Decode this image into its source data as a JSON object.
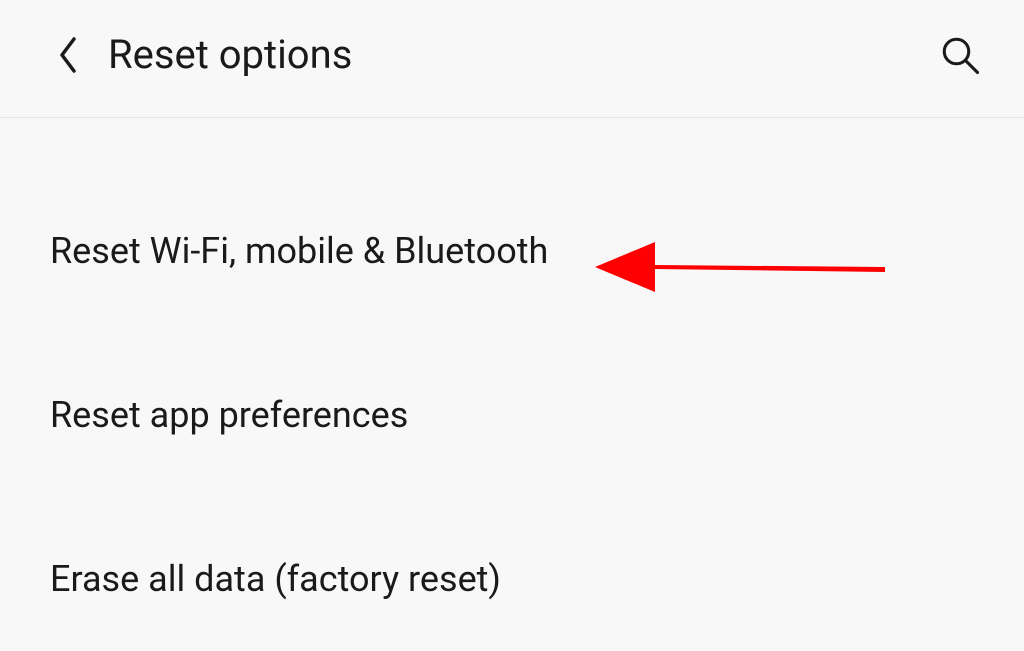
{
  "header": {
    "title": "Reset options"
  },
  "options": [
    {
      "label": "Reset Wi-Fi, mobile & Bluetooth"
    },
    {
      "label": "Reset app preferences"
    },
    {
      "label": "Erase all data (factory reset)"
    }
  ]
}
